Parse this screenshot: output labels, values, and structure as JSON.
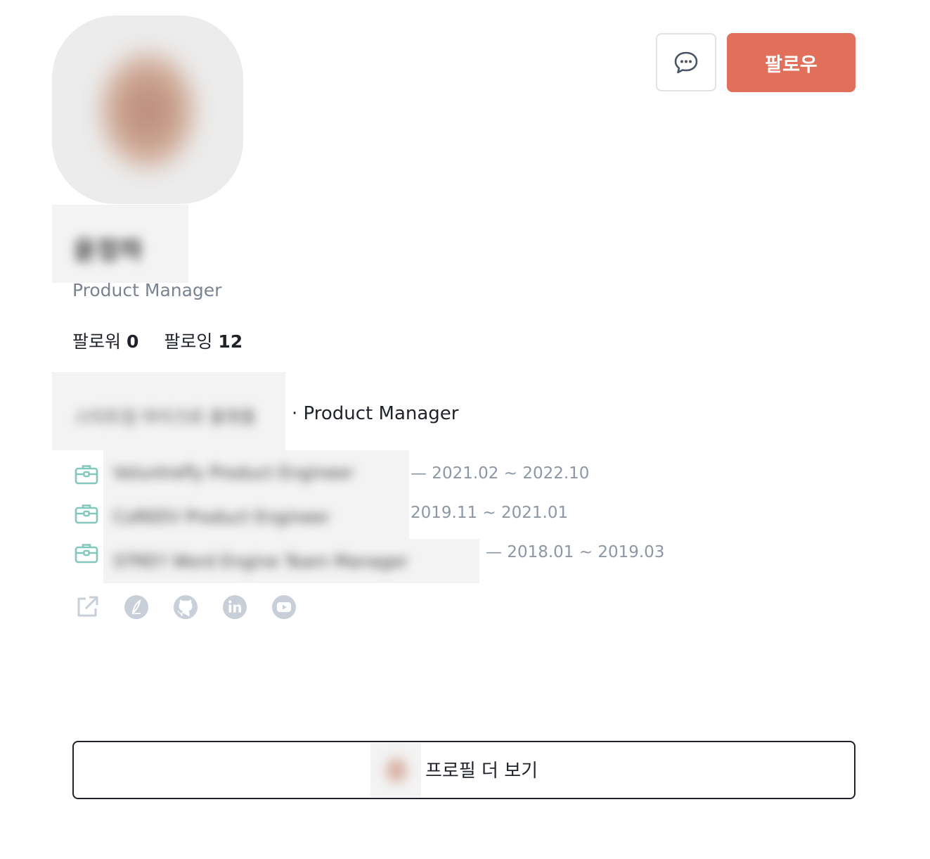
{
  "profile": {
    "name": "윤정하",
    "job_title": "Product Manager",
    "avatar_icon": "user-avatar"
  },
  "stats": {
    "followers_label": "팔로워",
    "followers_count": "0",
    "following_label": "팔로잉",
    "following_count": "12"
  },
  "current": {
    "company": "스타트업 마이크로 플랫폼",
    "role": "· Product Manager"
  },
  "career": [
    {
      "company": "Voluntrefly Product Engineer",
      "period": "— 2021.02 ~ 2022.10"
    },
    {
      "company": "CoREEV Product Engineer",
      "period": "2019.11 ~ 2021.01"
    },
    {
      "company": "STREY Word Engine Team Manager",
      "period": "— 2018.01 ~ 2019.03"
    }
  ],
  "social_links": [
    {
      "icon": "external-link-icon"
    },
    {
      "icon": "blog-pen-icon"
    },
    {
      "icon": "github-icon"
    },
    {
      "icon": "linkedin-icon"
    },
    {
      "icon": "youtube-icon"
    }
  ],
  "actions": {
    "message_icon": "chat-bubble-icon",
    "follow_label": "팔로우",
    "more_profile_label": "프로필 더 보기"
  },
  "colors": {
    "accent": "#e0705a",
    "career_icon": "#82c8bd",
    "social_icon": "#c9cfd8",
    "muted_text": "#8e96a3"
  }
}
